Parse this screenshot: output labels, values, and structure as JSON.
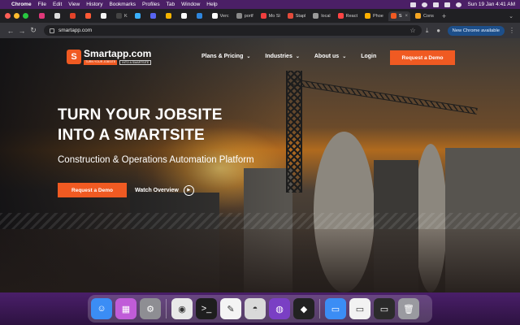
{
  "menubar": {
    "app": "Chrome",
    "items": [
      "File",
      "Edit",
      "View",
      "History",
      "Bookmarks",
      "Profiles",
      "Tab",
      "Window",
      "Help"
    ],
    "clock": "Sun 19 Jan  4:41 AM"
  },
  "browser": {
    "tabs": [
      {
        "label": "",
        "color": "#e0397a"
      },
      {
        "label": "",
        "color": "#dddddd"
      },
      {
        "label": "",
        "color": "#e24329"
      },
      {
        "label": "",
        "color": "#ff5a36"
      },
      {
        "label": "",
        "color": "#f6f6f6"
      },
      {
        "label": "K",
        "color": "#444444"
      },
      {
        "label": "",
        "color": "#3ab0ff"
      },
      {
        "label": "",
        "color": "#5865f2"
      },
      {
        "label": "",
        "color": "#f4b400"
      },
      {
        "label": "",
        "color": "#ffffff"
      },
      {
        "label": "",
        "color": "#2e86de"
      },
      {
        "label": "Verc",
        "color": "#ffffff"
      },
      {
        "label": "portf",
        "color": "#8a8a8a"
      },
      {
        "label": "Mo Sl",
        "color": "#f03e3e"
      },
      {
        "label": "Stapl",
        "color": "#e34b3b"
      },
      {
        "label": "local",
        "color": "#9a9a9a"
      },
      {
        "label": "React",
        "color": "#ff4444"
      },
      {
        "label": "Phoe",
        "color": "#ffb000"
      },
      {
        "label": "S",
        "color": "#f05a22",
        "active": true
      },
      {
        "label": "Cons",
        "color": "#f5a623"
      }
    ],
    "url": "smartapp.com",
    "update_label": "New Chrome available"
  },
  "site": {
    "logo_name": "Smartapp.com",
    "logo_mark": "S",
    "logo_tag_left": "TURN YOUR JOBSITE",
    "logo_tag_right": "INTO A SMARTSITE",
    "nav": {
      "plans": "Plans & Pricing",
      "industries": "Industries",
      "about": "About us",
      "login": "Login"
    },
    "demo_top": "Request a Demo",
    "hero": {
      "line1": "TURN YOUR JOBSITE",
      "line2": "INTO A SMARTSITE",
      "subtitle": "Construction & Operations Automation Platform",
      "cta": "Request a Demo",
      "watch": "Watch Overview"
    },
    "accent": "#f05a22"
  },
  "dock": {
    "apps": [
      {
        "name": "Finder",
        "color": "#3b8df5",
        "glyph": "☺"
      },
      {
        "name": "Launchpad",
        "color": "#c05cd8",
        "glyph": "▦"
      },
      {
        "name": "System Settings",
        "color": "#8e8e93",
        "glyph": "⚙"
      },
      {
        "name": "Chrome",
        "color": "#e8e8e8",
        "glyph": "◉"
      },
      {
        "name": "Terminal",
        "color": "#1e1e1e",
        "glyph": ">_"
      },
      {
        "name": "TextEdit",
        "color": "#f4f4f4",
        "glyph": "✎"
      },
      {
        "name": "MySQL Workbench",
        "color": "#d9d9d9",
        "glyph": "◓"
      },
      {
        "name": "GitHub Desktop",
        "color": "#7a3fc4",
        "glyph": "◍"
      },
      {
        "name": "Unity",
        "color": "#222222",
        "glyph": "◆"
      },
      {
        "name": "Downloads",
        "color": "#3b8df5",
        "glyph": "▭"
      },
      {
        "name": "Screenshot",
        "color": "#f2f2f2",
        "glyph": "▭"
      },
      {
        "name": "Screen Recording",
        "color": "#2b2b2b",
        "glyph": "▭"
      },
      {
        "name": "Trash",
        "color": "#9a9aa0",
        "glyph": "🗑"
      }
    ]
  }
}
